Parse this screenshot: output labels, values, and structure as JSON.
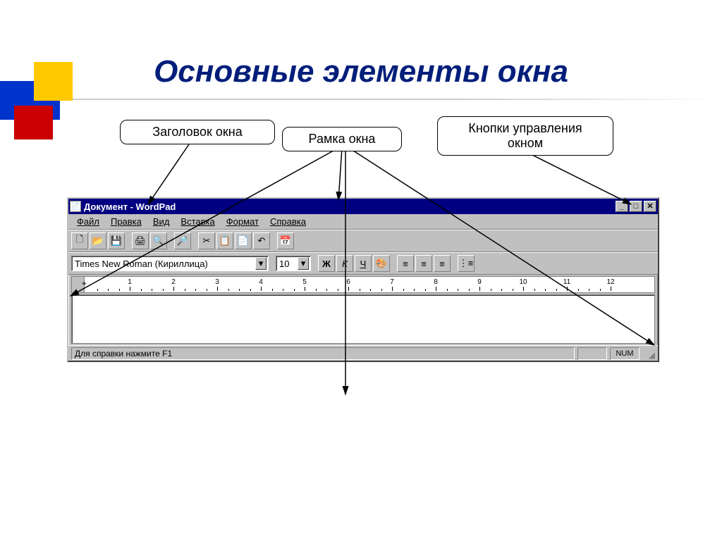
{
  "slide": {
    "title": "Основные элементы окна"
  },
  "callouts": {
    "title_label": "Заголовок окна",
    "frame_label": "Рамка окна",
    "controls_label": "Кнопки управления окном"
  },
  "window": {
    "title": "Документ - WordPad"
  },
  "menu": {
    "file": "Файл",
    "edit": "Правка",
    "view": "Вид",
    "insert": "Вставка",
    "format": "Формат",
    "help": "Справка"
  },
  "format": {
    "font": "Times New Roman (Кириллица)",
    "size": "10",
    "bold": "Ж",
    "italic": "К",
    "underline": "Ч"
  },
  "ruler": {
    "labels": [
      "1",
      "2",
      "3",
      "4",
      "5",
      "6",
      "7",
      "8",
      "9",
      "10",
      "11",
      "12"
    ]
  },
  "status": {
    "help": "Для справки нажмите F1",
    "num": "NUM"
  }
}
